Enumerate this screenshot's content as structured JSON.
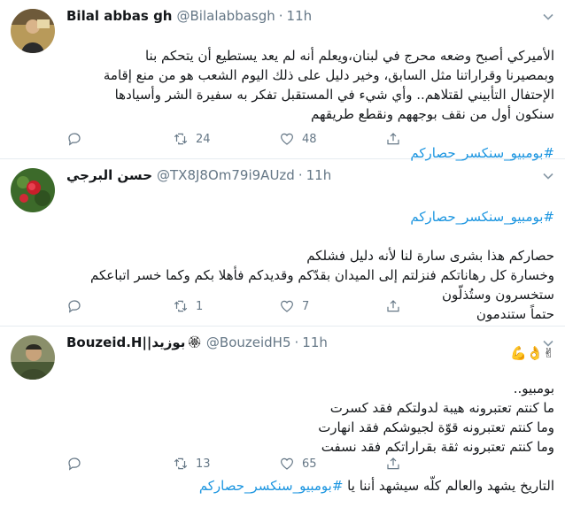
{
  "tweets": [
    {
      "name": "Bilal abbas gh",
      "handle": "@Bilalabbasgh",
      "sep": "·",
      "time": "11h",
      "text": "الأميركي أصبح وضعه محرج في لبنان،ويعلم أنه لم يعد يستطيع أن يتحكم بنا\nوبمصيرنا وقراراتنا مثل السابق، وخير دليل على ذلك اليوم الشعب هو من منع إقامة\nالإحتفال التأبيني لقتلاهم.. وأي شيء في المستقبل تفكر به سفيرة الشر وأسيادها\nسنكون أول من نقف بوجههم ونقطع طريقهم",
      "hashtag": "#بومبيو_سنكسر_حصاركم",
      "replies": "",
      "retweets": "24",
      "likes": "48"
    },
    {
      "name": "حسن البرجي",
      "handle": "@TX8J8Om79i9AUzd",
      "sep": "·",
      "time": "11h",
      "hashtag": "#بومبيو_سنكسر_حصاركم",
      "text": "حصاركم هذا بشرى سارة لنا لأنه دليل فشلكم\nوخسارة كل رهاناتكم فنزلتم إلى الميدان بقدّكم وقديدكم فأهلا بكم وكما خسر اتباعكم\nستخسرون وستُذلّون\nحتماً ستندمون",
      "emoji": "✌👌💪",
      "replies": "",
      "retweets": "1",
      "likes": "7"
    },
    {
      "name": "Bouzeid.H||بوزيد",
      "name_emoji": "🏵",
      "handle": "@BouzeidH5",
      "sep": "·",
      "time": "11h",
      "text": "بومبيو..\nما كنتم تعتبرونه هيبة لدولتكم فقد كسرت\nوما كنتم تعتبرونه قوّة لجيوشكم فقد انهارت\nوما كنتم تعتبرونه ثقة بقراراتكم فقد نسفت",
      "text_last_prefix": "التاريخ يشهد والعالم كلّه سيشهد أننا يا ",
      "hashtag": "#بومبيو_سنكسر_حصاركم",
      "replies": "",
      "retweets": "13",
      "likes": "65"
    }
  ]
}
